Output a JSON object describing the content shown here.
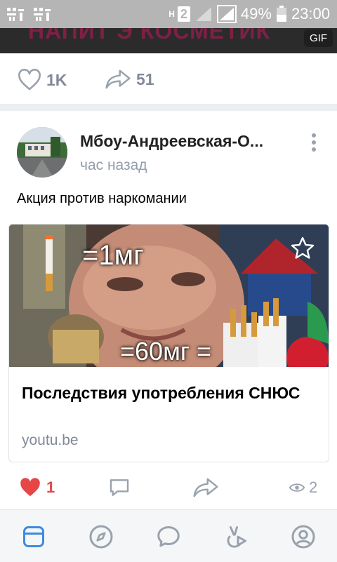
{
  "status_bar": {
    "battery": "49%",
    "time": "23:00",
    "network_letter": "H",
    "sim_number": "2"
  },
  "top_post": {
    "gif_badge": "GIF",
    "likes": "1K",
    "shares": "51"
  },
  "post": {
    "author": "Мбоу-Андреевская-О...",
    "time": "час назад",
    "text": "Акция против наркомании",
    "link_card": {
      "thumbnail_overlay_top": "=1мг",
      "thumbnail_overlay_bottom": "=60мг =",
      "title": "Последствия употребления СНЮС",
      "domain": "youtu.be"
    },
    "likes": "1",
    "views": "2"
  },
  "colors": {
    "like_active": "#e64646",
    "accent": "#3f8ae0",
    "icon_gray": "#99a2ad"
  },
  "icons": {
    "status_bar": [
      "app-notification-icon",
      "app-notification-icon",
      "network-h-icon",
      "sim-2-icon",
      "signal-icon",
      "signal-icon",
      "battery-icon"
    ],
    "top_actions": [
      "heart-icon",
      "share-icon"
    ],
    "post_header": [
      "more-vertical-icon"
    ],
    "card": [
      "bookmark-star-icon"
    ],
    "post_actions": [
      "heart-filled-icon",
      "comment-icon",
      "share-icon",
      "eye-icon"
    ],
    "bottom_nav": [
      "newsfeed-icon",
      "explore-compass-icon",
      "messages-icon",
      "clips-icon",
      "profile-icon"
    ]
  }
}
